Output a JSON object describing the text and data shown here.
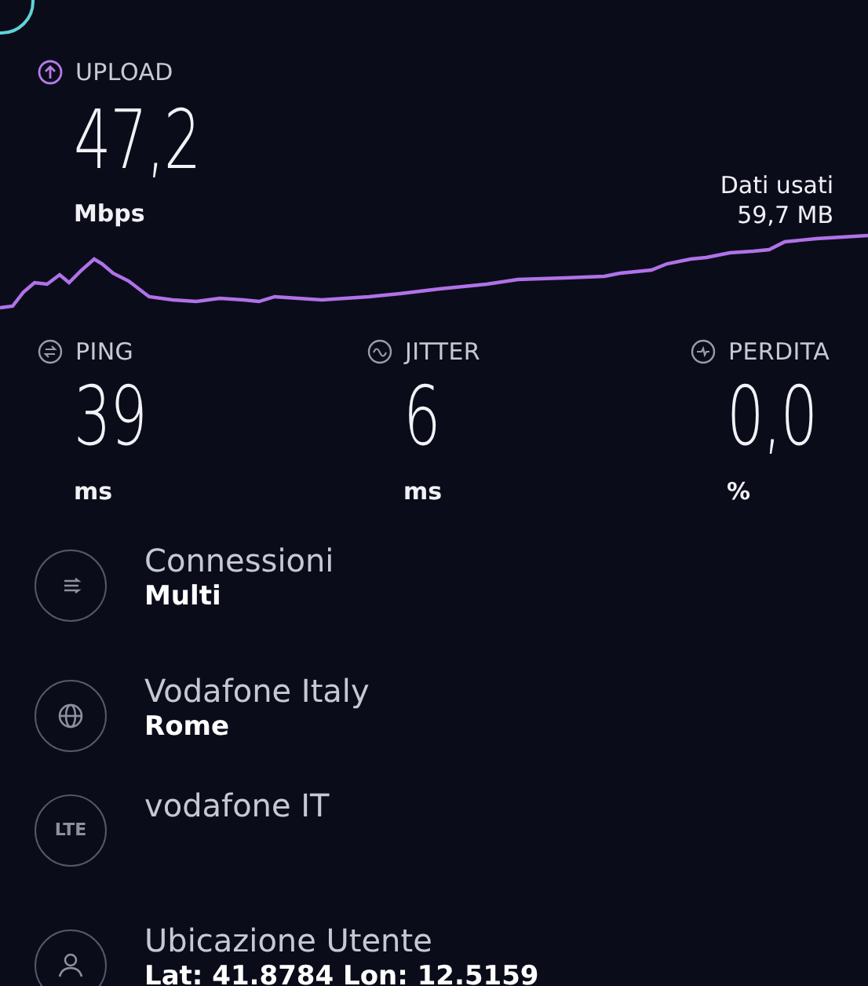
{
  "upload": {
    "label": "UPLOAD",
    "value": "47,2",
    "unit": "Mbps"
  },
  "data_used": {
    "label": "Dati usati",
    "value": "59,7 MB"
  },
  "metrics": [
    {
      "kind": "ping",
      "label": "PING",
      "value": "39",
      "unit": "ms"
    },
    {
      "kind": "jitter",
      "label": "JITTER",
      "value": "6",
      "unit": "ms"
    },
    {
      "kind": "loss",
      "label": "PERDITA",
      "value": "0,0",
      "unit": "%"
    }
  ],
  "details": [
    {
      "kind": "connections",
      "title": "Connessioni",
      "subtitle": "Multi"
    },
    {
      "kind": "server",
      "title": "Vodafone Italy",
      "subtitle": "Rome"
    },
    {
      "kind": "network",
      "badge": "LTE",
      "title": "vodafone IT"
    },
    {
      "kind": "user",
      "title": "Ubicazione Utente",
      "subtitle": "Lat: 41.8784 Lon: 12.5159"
    }
  ]
}
